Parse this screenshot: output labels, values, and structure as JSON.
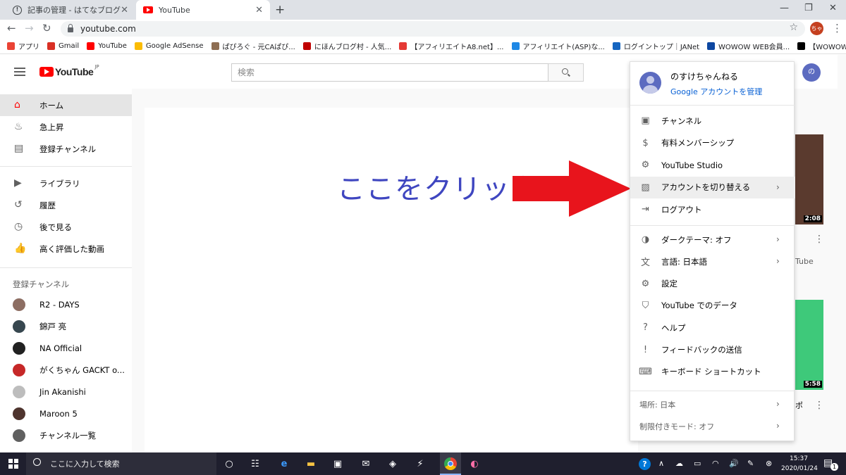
{
  "browser": {
    "tabs": [
      {
        "title": "記事の管理 - はてなブログ"
      },
      {
        "title": "YouTube"
      }
    ],
    "url": "youtube.com",
    "profile_initial": "ちゃ",
    "bookmarks": [
      {
        "label": "アプリ",
        "icon_color": "#ea4335"
      },
      {
        "label": "Gmail",
        "icon_color": "#d93025"
      },
      {
        "label": "YouTube",
        "icon_color": "#ff0000"
      },
      {
        "label": "Google AdSense",
        "icon_color": "#fbbc04"
      },
      {
        "label": "ぱぴろぐ - 元CAぱぴ...",
        "icon_color": "#8e6e53"
      },
      {
        "label": "にほんブログ村 - 人気...",
        "icon_color": "#c00000"
      },
      {
        "label": "【アフィリエイトA8.net】...",
        "icon_color": "#e53935"
      },
      {
        "label": "アフィリエイト(ASP)な...",
        "icon_color": "#1e88e5"
      },
      {
        "label": "ログイントップ｜JANet",
        "icon_color": "#1565c0"
      },
      {
        "label": "WOWOW WEB会員...",
        "icon_color": "#0d47a1"
      },
      {
        "label": "【WOWOWメンバーズ...",
        "icon_color": "#000000"
      }
    ]
  },
  "youtube": {
    "logo_text": "YouTube",
    "logo_region": "JP",
    "search_placeholder": "検索",
    "avatar_initial": "の",
    "sidebar": {
      "main": [
        {
          "label": "ホーム",
          "icon": "home-icon",
          "active": true
        },
        {
          "label": "急上昇",
          "icon": "flame-icon"
        },
        {
          "label": "登録チャンネル",
          "icon": "subscriptions-icon"
        }
      ],
      "library": [
        {
          "label": "ライブラリ",
          "icon": "library-icon"
        },
        {
          "label": "履歴",
          "icon": "history-icon"
        },
        {
          "label": "後で見る",
          "icon": "clock-icon"
        },
        {
          "label": "高く評価した動画",
          "icon": "thumbs-up-icon"
        }
      ],
      "subs_heading": "登録チャンネル",
      "channels": [
        {
          "label": "R2 - DAYS",
          "color": "#8d6e63"
        },
        {
          "label": "錦戸 亮",
          "color": "#37474f"
        },
        {
          "label": "NA Official",
          "color": "#212121"
        },
        {
          "label": "がくちゃん GACKT o...",
          "color": "#c62828"
        },
        {
          "label": "Jin Akanishi",
          "color": "#bdbdbd"
        },
        {
          "label": "Maroon 5",
          "color": "#4e342e"
        },
        {
          "label": "チャンネル一覧",
          "color": "#606060"
        }
      ]
    },
    "annotation": "ここをクリック",
    "annotation_color": "#3f46c0",
    "arrow_color": "#e8141c",
    "durations": [
      "2:08",
      "5:58"
    ],
    "bg_fragments": {
      "ube": "Tube",
      "bo": "ポ"
    },
    "menu": {
      "user_name": "のすけちゃんねる",
      "manage_account": "Google アカウントを管理",
      "group1": [
        {
          "label": "チャンネル",
          "icon": "person-icon"
        },
        {
          "label": "有料メンバーシップ",
          "icon": "dollar-icon"
        },
        {
          "label": "YouTube Studio",
          "icon": "gear-icon"
        },
        {
          "label": "アカウントを切り替える",
          "icon": "switch-account-icon",
          "chevron": true,
          "highlight": true
        },
        {
          "label": "ログアウト",
          "icon": "logout-icon"
        }
      ],
      "group2": [
        {
          "label": "ダークテーマ: オフ",
          "icon": "dark-theme-icon",
          "chevron": true
        },
        {
          "label": "言語: 日本語",
          "icon": "translate-icon",
          "chevron": true
        },
        {
          "label": "設定",
          "icon": "settings-icon"
        },
        {
          "label": "YouTube でのデータ",
          "icon": "shield-icon"
        },
        {
          "label": "ヘルプ",
          "icon": "help-icon"
        },
        {
          "label": "フィードバックの送信",
          "icon": "feedback-icon"
        },
        {
          "label": "キーボード ショートカット",
          "icon": "keyboard-icon"
        }
      ],
      "group3": [
        {
          "label": "場所: 日本",
          "chevron": true
        },
        {
          "label": "制限付きモード: オフ",
          "chevron": true
        }
      ]
    }
  },
  "taskbar": {
    "search_placeholder": "ここに入力して検索",
    "time": "15:37",
    "date": "2020/01/24",
    "notification_count": "1"
  }
}
